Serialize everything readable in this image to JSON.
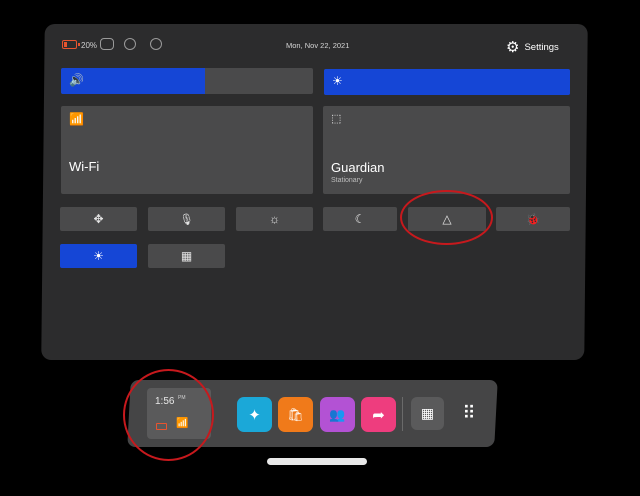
{
  "status": {
    "battery_pct": "20%",
    "date": "Mon, Nov 22, 2021",
    "settings_label": "Settings"
  },
  "sliders": {
    "volume": {
      "icon": "volume-icon",
      "level": 0.57
    },
    "brightness": {
      "icon": "brightness-icon",
      "level": 1.0
    }
  },
  "tiles": {
    "wifi": {
      "label": "Wi-Fi",
      "icon": "wifi-icon"
    },
    "guardian": {
      "label": "Guardian",
      "sublabel": "Stationary",
      "icon": "guardian-icon"
    }
  },
  "quick_buttons": [
    {
      "name": "recenter-button",
      "icon": "move-arrows-icon",
      "glyph": "✥",
      "active": false
    },
    {
      "name": "mic-mute-button",
      "icon": "mic-off-icon",
      "glyph": "🎙",
      "active": false
    },
    {
      "name": "passthrough-button",
      "icon": "sun-small-icon",
      "glyph": "☼",
      "active": false
    },
    {
      "name": "night-display-button",
      "icon": "moon-icon",
      "glyph": "☾",
      "active": false
    },
    {
      "name": "triangle-button",
      "icon": "triangle-icon",
      "glyph": "△",
      "active": false
    },
    {
      "name": "bug-report-button",
      "icon": "bug-icon",
      "glyph": "🐞",
      "active": false
    },
    {
      "name": "display-mode-button",
      "icon": "bright-sun-icon",
      "glyph": "☀",
      "active": true
    },
    {
      "name": "grid-layout-button",
      "icon": "grid-icon",
      "glyph": "▦",
      "active": false
    }
  ],
  "dock": {
    "time": "1:56",
    "ampm": "PM",
    "apps": [
      {
        "name": "explore-app",
        "icon": "compass-icon",
        "glyph": "✦",
        "color": "#1ba8d8"
      },
      {
        "name": "store-app",
        "icon": "shopping-bag-icon",
        "glyph": "🛍",
        "color": "#f07a1a"
      },
      {
        "name": "people-app",
        "icon": "people-icon",
        "glyph": "👥",
        "color": "#b352d4"
      },
      {
        "name": "share-app",
        "icon": "share-arrow-icon",
        "glyph": "➦",
        "color": "#ee3d7e"
      }
    ],
    "quick_settings_icon": "quick-settings-grid-icon",
    "app_library_icon": "app-library-icon"
  },
  "colors": {
    "accent": "#1546d6",
    "annotation": "#c7191d",
    "battery": "#e8542f"
  }
}
